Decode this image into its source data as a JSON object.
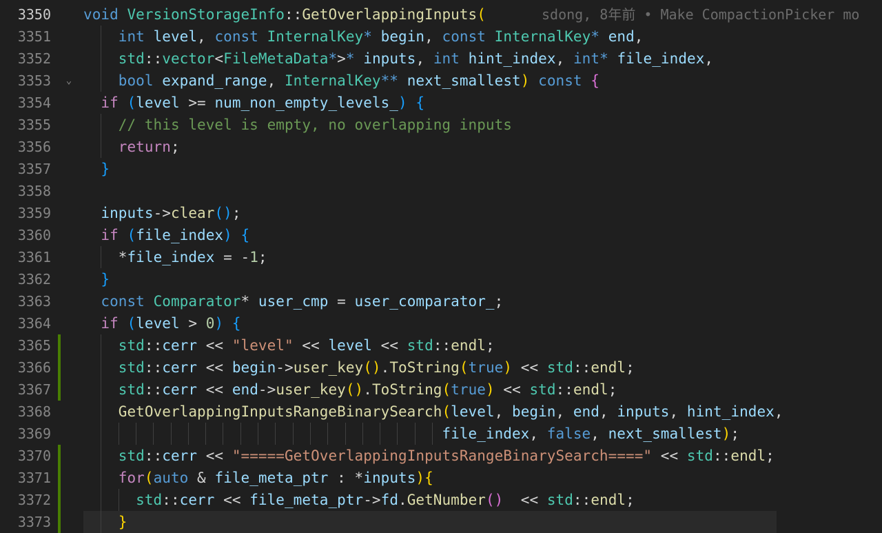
{
  "blame": {
    "text": "sdong, 8年前 • Make CompactionPicker mo"
  },
  "lines": [
    {
      "no": "3350",
      "active": true,
      "mark": false,
      "fold": "",
      "tokens": [
        [
          "kw",
          "void"
        ],
        [
          "plain",
          " "
        ],
        [
          "ty",
          "VersionStorageInfo"
        ],
        [
          "plain",
          "::"
        ],
        [
          "fn",
          "GetOverlappingInputs"
        ],
        [
          "p1",
          "("
        ]
      ]
    },
    {
      "no": "3351",
      "active": false,
      "mark": false,
      "fold": "",
      "tokens": [
        [
          "plain",
          "    "
        ],
        [
          "kw",
          "int"
        ],
        [
          "plain",
          " "
        ],
        [
          "va",
          "level"
        ],
        [
          "plain",
          ", "
        ],
        [
          "kw",
          "const"
        ],
        [
          "plain",
          " "
        ],
        [
          "ty",
          "InternalKey"
        ],
        [
          "kw",
          "*"
        ],
        [
          "plain",
          " "
        ],
        [
          "va",
          "begin"
        ],
        [
          "plain",
          ", "
        ],
        [
          "kw",
          "const"
        ],
        [
          "plain",
          " "
        ],
        [
          "ty",
          "InternalKey"
        ],
        [
          "kw",
          "*"
        ],
        [
          "plain",
          " "
        ],
        [
          "va",
          "end"
        ],
        [
          "plain",
          ","
        ]
      ]
    },
    {
      "no": "3352",
      "active": false,
      "mark": false,
      "fold": "",
      "tokens": [
        [
          "plain",
          "    "
        ],
        [
          "ty",
          "std"
        ],
        [
          "plain",
          "::"
        ],
        [
          "ty",
          "vector"
        ],
        [
          "plain",
          "<"
        ],
        [
          "ty",
          "FileMetaData"
        ],
        [
          "kw",
          "*"
        ],
        [
          "plain",
          ">"
        ],
        [
          "kw",
          "*"
        ],
        [
          "plain",
          " "
        ],
        [
          "va",
          "inputs"
        ],
        [
          "plain",
          ", "
        ],
        [
          "kw",
          "int"
        ],
        [
          "plain",
          " "
        ],
        [
          "va",
          "hint_index"
        ],
        [
          "plain",
          ", "
        ],
        [
          "kw",
          "int"
        ],
        [
          "kw",
          "*"
        ],
        [
          "plain",
          " "
        ],
        [
          "va",
          "file_index"
        ],
        [
          "plain",
          ","
        ]
      ]
    },
    {
      "no": "3353",
      "active": false,
      "mark": false,
      "fold": "⌄",
      "tokens": [
        [
          "plain",
          "    "
        ],
        [
          "kw",
          "bool"
        ],
        [
          "plain",
          " "
        ],
        [
          "va",
          "expand_range"
        ],
        [
          "plain",
          ", "
        ],
        [
          "ty",
          "InternalKey"
        ],
        [
          "kw",
          "**"
        ],
        [
          "plain",
          " "
        ],
        [
          "va",
          "next_smallest"
        ],
        [
          "p1",
          ")"
        ],
        [
          "plain",
          " "
        ],
        [
          "kw",
          "const"
        ],
        [
          "plain",
          " "
        ],
        [
          "p2",
          "{"
        ]
      ]
    },
    {
      "no": "3354",
      "active": false,
      "mark": false,
      "fold": "",
      "tokens": [
        [
          "plain",
          "  "
        ],
        [
          "ctl",
          "if"
        ],
        [
          "plain",
          " "
        ],
        [
          "p3",
          "("
        ],
        [
          "va",
          "level"
        ],
        [
          "plain",
          " >= "
        ],
        [
          "va",
          "num_non_empty_levels_"
        ],
        [
          "p3",
          ")"
        ],
        [
          "plain",
          " "
        ],
        [
          "p3",
          "{"
        ]
      ]
    },
    {
      "no": "3355",
      "active": false,
      "mark": false,
      "fold": "",
      "tokens": [
        [
          "plain",
          "    "
        ],
        [
          "cm",
          "// this level is empty, no overlapping inputs"
        ]
      ]
    },
    {
      "no": "3356",
      "active": false,
      "mark": false,
      "fold": "",
      "tokens": [
        [
          "plain",
          "    "
        ],
        [
          "ctl",
          "return"
        ],
        [
          "plain",
          ";"
        ]
      ]
    },
    {
      "no": "3357",
      "active": false,
      "mark": false,
      "fold": "",
      "tokens": [
        [
          "plain",
          "  "
        ],
        [
          "p3",
          "}"
        ]
      ]
    },
    {
      "no": "3358",
      "active": false,
      "mark": false,
      "fold": "",
      "tokens": []
    },
    {
      "no": "3359",
      "active": false,
      "mark": false,
      "fold": "",
      "tokens": [
        [
          "plain",
          "  "
        ],
        [
          "va",
          "inputs"
        ],
        [
          "plain",
          "->"
        ],
        [
          "fn",
          "clear"
        ],
        [
          "p3",
          "()"
        ],
        [
          "plain",
          ";"
        ]
      ]
    },
    {
      "no": "3360",
      "active": false,
      "mark": false,
      "fold": "",
      "tokens": [
        [
          "plain",
          "  "
        ],
        [
          "ctl",
          "if"
        ],
        [
          "plain",
          " "
        ],
        [
          "p3",
          "("
        ],
        [
          "va",
          "file_index"
        ],
        [
          "p3",
          ")"
        ],
        [
          "plain",
          " "
        ],
        [
          "p3",
          "{"
        ]
      ]
    },
    {
      "no": "3361",
      "active": false,
      "mark": false,
      "fold": "",
      "tokens": [
        [
          "plain",
          "    "
        ],
        [
          "plain",
          "*"
        ],
        [
          "va",
          "file_index"
        ],
        [
          "plain",
          " = -"
        ],
        [
          "num",
          "1"
        ],
        [
          "plain",
          ";"
        ]
      ]
    },
    {
      "no": "3362",
      "active": false,
      "mark": false,
      "fold": "",
      "tokens": [
        [
          "plain",
          "  "
        ],
        [
          "p3",
          "}"
        ]
      ]
    },
    {
      "no": "3363",
      "active": false,
      "mark": false,
      "fold": "",
      "tokens": [
        [
          "plain",
          "  "
        ],
        [
          "kw",
          "const"
        ],
        [
          "plain",
          " "
        ],
        [
          "ty",
          "Comparator"
        ],
        [
          "plain",
          "* "
        ],
        [
          "va",
          "user_cmp"
        ],
        [
          "plain",
          " = "
        ],
        [
          "va",
          "user_comparator_"
        ],
        [
          "plain",
          ";"
        ]
      ]
    },
    {
      "no": "3364",
      "active": false,
      "mark": false,
      "fold": "",
      "tokens": [
        [
          "plain",
          "  "
        ],
        [
          "ctl",
          "if"
        ],
        [
          "plain",
          " "
        ],
        [
          "p3",
          "("
        ],
        [
          "va",
          "level"
        ],
        [
          "plain",
          " > "
        ],
        [
          "num",
          "0"
        ],
        [
          "p3",
          ")"
        ],
        [
          "plain",
          " "
        ],
        [
          "p3",
          "{"
        ]
      ]
    },
    {
      "no": "3365",
      "active": false,
      "mark": true,
      "fold": "",
      "tokens": [
        [
          "plain",
          "    "
        ],
        [
          "ty",
          "std"
        ],
        [
          "plain",
          "::"
        ],
        [
          "va",
          "cerr"
        ],
        [
          "plain",
          " << "
        ],
        [
          "str",
          "\"level\""
        ],
        [
          "plain",
          " << "
        ],
        [
          "va",
          "level"
        ],
        [
          "plain",
          " << "
        ],
        [
          "ty",
          "std"
        ],
        [
          "plain",
          "::"
        ],
        [
          "fn",
          "endl"
        ],
        [
          "plain",
          ";"
        ]
      ]
    },
    {
      "no": "3366",
      "active": false,
      "mark": true,
      "fold": "",
      "tokens": [
        [
          "plain",
          "    "
        ],
        [
          "ty",
          "std"
        ],
        [
          "plain",
          "::"
        ],
        [
          "va",
          "cerr"
        ],
        [
          "plain",
          " << "
        ],
        [
          "va",
          "begin"
        ],
        [
          "plain",
          "->"
        ],
        [
          "fn",
          "user_key"
        ],
        [
          "p1",
          "()"
        ],
        [
          "plain",
          "."
        ],
        [
          "fn",
          "ToString"
        ],
        [
          "p1",
          "("
        ],
        [
          "kw",
          "true"
        ],
        [
          "p1",
          ")"
        ],
        [
          "plain",
          " << "
        ],
        [
          "ty",
          "std"
        ],
        [
          "plain",
          "::"
        ],
        [
          "fn",
          "endl"
        ],
        [
          "plain",
          ";"
        ]
      ]
    },
    {
      "no": "3367",
      "active": false,
      "mark": true,
      "fold": "",
      "tokens": [
        [
          "plain",
          "    "
        ],
        [
          "ty",
          "std"
        ],
        [
          "plain",
          "::"
        ],
        [
          "va",
          "cerr"
        ],
        [
          "plain",
          " << "
        ],
        [
          "va",
          "end"
        ],
        [
          "plain",
          "->"
        ],
        [
          "fn",
          "user_key"
        ],
        [
          "p1",
          "()"
        ],
        [
          "plain",
          "."
        ],
        [
          "fn",
          "ToString"
        ],
        [
          "p1",
          "("
        ],
        [
          "kw",
          "true"
        ],
        [
          "p1",
          ")"
        ],
        [
          "plain",
          " << "
        ],
        [
          "ty",
          "std"
        ],
        [
          "plain",
          "::"
        ],
        [
          "fn",
          "endl"
        ],
        [
          "plain",
          ";"
        ]
      ]
    },
    {
      "no": "3368",
      "active": false,
      "mark": false,
      "fold": "",
      "tokens": [
        [
          "plain",
          "    "
        ],
        [
          "fn",
          "GetOverlappingInputsRangeBinarySearch"
        ],
        [
          "p1",
          "("
        ],
        [
          "va",
          "level"
        ],
        [
          "plain",
          ", "
        ],
        [
          "va",
          "begin"
        ],
        [
          "plain",
          ", "
        ],
        [
          "va",
          "end"
        ],
        [
          "plain",
          ", "
        ],
        [
          "va",
          "inputs"
        ],
        [
          "plain",
          ", "
        ],
        [
          "va",
          "hint_index"
        ],
        [
          "plain",
          ","
        ]
      ]
    },
    {
      "no": "3369",
      "active": false,
      "mark": false,
      "fold": "",
      "tokens": [
        [
          "plain",
          "                                         "
        ],
        [
          "va",
          "file_index"
        ],
        [
          "plain",
          ", "
        ],
        [
          "kw",
          "false"
        ],
        [
          "plain",
          ", "
        ],
        [
          "va",
          "next_smallest"
        ],
        [
          "p1",
          ")"
        ],
        [
          "plain",
          ";"
        ]
      ]
    },
    {
      "no": "3370",
      "active": false,
      "mark": true,
      "fold": "",
      "tokens": [
        [
          "plain",
          "    "
        ],
        [
          "ty",
          "std"
        ],
        [
          "plain",
          "::"
        ],
        [
          "va",
          "cerr"
        ],
        [
          "plain",
          " << "
        ],
        [
          "str",
          "\"=====GetOverlappingInputsRangeBinarySearch====\""
        ],
        [
          "plain",
          " << "
        ],
        [
          "ty",
          "std"
        ],
        [
          "plain",
          "::"
        ],
        [
          "fn",
          "endl"
        ],
        [
          "plain",
          ";"
        ]
      ]
    },
    {
      "no": "3371",
      "active": false,
      "mark": true,
      "fold": "",
      "tokens": [
        [
          "plain",
          "    "
        ],
        [
          "ctl",
          "for"
        ],
        [
          "p1",
          "("
        ],
        [
          "kw",
          "auto"
        ],
        [
          "plain",
          " & "
        ],
        [
          "va",
          "file_meta_ptr"
        ],
        [
          "plain",
          " : *"
        ],
        [
          "va",
          "inputs"
        ],
        [
          "p1",
          ")"
        ],
        [
          "p1",
          "{"
        ]
      ]
    },
    {
      "no": "3372",
      "active": false,
      "mark": true,
      "fold": "",
      "tokens": [
        [
          "plain",
          "      "
        ],
        [
          "ty",
          "std"
        ],
        [
          "plain",
          "::"
        ],
        [
          "va",
          "cerr"
        ],
        [
          "plain",
          " << "
        ],
        [
          "va",
          "file_meta_ptr"
        ],
        [
          "plain",
          "->"
        ],
        [
          "va",
          "fd"
        ],
        [
          "plain",
          "."
        ],
        [
          "fn",
          "GetNumber"
        ],
        [
          "p2",
          "()"
        ],
        [
          "plain",
          "  << "
        ],
        [
          "ty",
          "std"
        ],
        [
          "plain",
          "::"
        ],
        [
          "fn",
          "endl"
        ],
        [
          "plain",
          ";"
        ]
      ]
    },
    {
      "no": "3373",
      "active": false,
      "mark": true,
      "fold": "",
      "tokens": [
        [
          "plain",
          "    "
        ],
        [
          "p1",
          "}"
        ]
      ]
    }
  ]
}
